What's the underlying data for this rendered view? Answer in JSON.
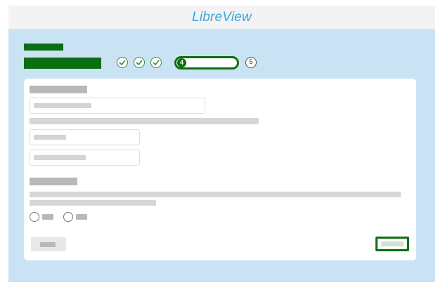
{
  "header": {
    "logo_text": "LibreView",
    "logo_color": "#3aa6dc"
  },
  "wizard": {
    "completed_steps": 3,
    "current_step": "4",
    "next_step": "5",
    "accent_color": "#0b6e12"
  },
  "form": {
    "radio_options": 2
  },
  "colors": {
    "background": "#c9e3f4",
    "card": "#ffffff"
  }
}
